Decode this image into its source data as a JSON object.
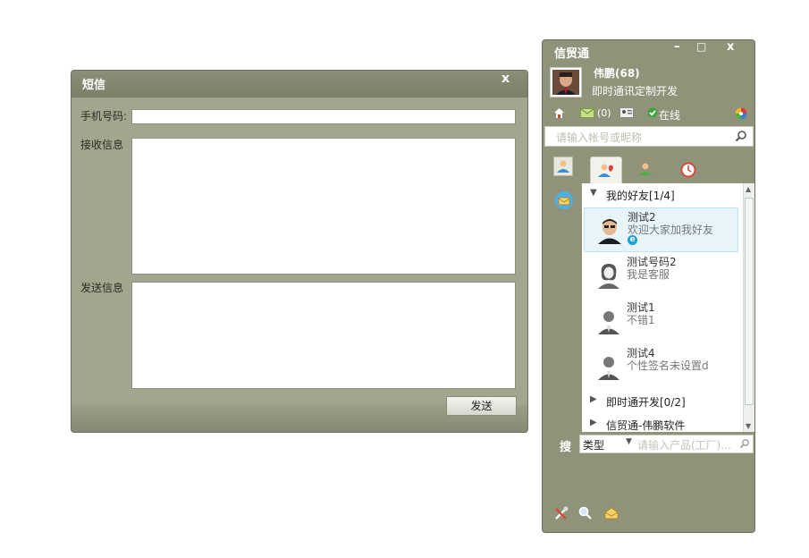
{
  "sms": {
    "title": "短信",
    "close": "x",
    "phone_label": "手机号码:",
    "phone_value": "",
    "receive_label": "接收信息",
    "receive_value": "",
    "send_label": "发送信息",
    "send_value": "",
    "send_button": "发送"
  },
  "im": {
    "title": "信贸通",
    "min": "–",
    "max": "□",
    "close": "x",
    "user_name": "伟鹏(68)",
    "user_signature": "即时通讯定制开发",
    "mail_count": "(0)",
    "status": "在线",
    "search_placeholder": "请输入帐号或昵称",
    "groups": [
      {
        "label": "我的好友[1/4]",
        "expanded": true
      },
      {
        "label": "即时通开发[0/2]",
        "expanded": false
      },
      {
        "label": "信贸通-伟鹏软件",
        "expanded": false
      }
    ],
    "friends": [
      {
        "name": "测试2",
        "signature": "欢迎大家加我好友",
        "selected": true,
        "badge": "e"
      },
      {
        "name": "测试号码2",
        "signature": "我是客服",
        "selected": false
      },
      {
        "name": "测试1",
        "signature": "不错1",
        "selected": false
      },
      {
        "name": "测试4",
        "signature": "个性签名未设置d",
        "selected": false
      }
    ],
    "product_search_label": "搜",
    "type_value": "类型",
    "product_placeholder": "请输入产品(工厂)..."
  },
  "colors": {
    "window_bg": "#a3a58f",
    "im_bg": "#909379",
    "selected_row": "#e7f5fb",
    "badge": "#1a9fd6"
  }
}
